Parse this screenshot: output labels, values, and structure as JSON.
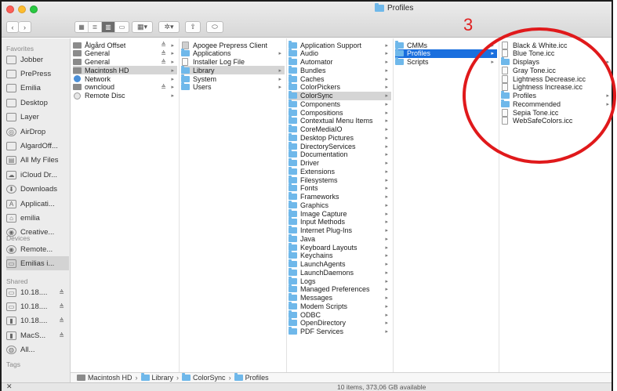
{
  "window": {
    "title": "Profiles"
  },
  "annotation": {
    "number": "3"
  },
  "toolbar": {
    "back": "‹",
    "forward": "›"
  },
  "sidebar": {
    "favorites_heading": "Favorites",
    "favorites": [
      {
        "label": "Jobber",
        "icon": "folder-icon"
      },
      {
        "label": "PrePress",
        "icon": "folder-icon"
      },
      {
        "label": "Emilia",
        "icon": "folder-icon"
      },
      {
        "label": "Desktop",
        "icon": "desktop-icon"
      },
      {
        "label": "Layer",
        "icon": "folder-icon"
      },
      {
        "label": "AirDrop",
        "icon": "airdrop-icon"
      },
      {
        "label": "AlgardOff...",
        "icon": "folder-icon"
      },
      {
        "label": "All My Files",
        "icon": "all-files-icon"
      },
      {
        "label": "iCloud Dr...",
        "icon": "cloud-icon"
      },
      {
        "label": "Downloads",
        "icon": "download-icon"
      },
      {
        "label": "Applicati...",
        "icon": "applications-icon"
      },
      {
        "label": "emilia",
        "icon": "home-icon"
      },
      {
        "label": "Creative...",
        "icon": "creative-cloud-icon"
      }
    ],
    "devices_heading": "Devices",
    "devices": [
      {
        "label": "Remote...",
        "icon": "disc-icon"
      },
      {
        "label": "Emilias i...",
        "icon": "computer-icon",
        "selected": true
      }
    ],
    "shared_heading": "Shared",
    "shared": [
      {
        "label": "10.18....",
        "icon": "display-icon",
        "eject": "≜"
      },
      {
        "label": "10.18....",
        "icon": "display-icon",
        "eject": "≜"
      },
      {
        "label": "10.18....",
        "icon": "server-icon",
        "eject": "≜"
      },
      {
        "label": "MacS...",
        "icon": "server-icon",
        "eject": "≜"
      },
      {
        "label": "All...",
        "icon": "network-icon"
      }
    ],
    "tags_heading": "Tags"
  },
  "columns": {
    "col1": [
      {
        "label": "Ålgård Offset",
        "icon": "drive",
        "eject": "≜",
        "chev": "▸"
      },
      {
        "label": "General",
        "icon": "drive",
        "eject": "≜",
        "chev": "▸"
      },
      {
        "label": "General",
        "icon": "drive",
        "eject": "≜",
        "chev": "▸"
      },
      {
        "label": "Macintosh HD",
        "icon": "drive",
        "chev": "▸",
        "selected": true
      },
      {
        "label": "Network",
        "icon": "net",
        "chev": "▸"
      },
      {
        "label": "owncloud",
        "icon": "drive",
        "eject": "≜",
        "chev": "▸"
      },
      {
        "label": "Remote Disc",
        "icon": "disc",
        "chev": "▸"
      }
    ],
    "col2": [
      {
        "label": "Apogee Prepress Client",
        "icon": "app"
      },
      {
        "label": "Applications",
        "icon": "folder",
        "chev": "▸"
      },
      {
        "label": "Installer Log File",
        "icon": "doc"
      },
      {
        "label": "Library",
        "icon": "folder",
        "chev": "▸",
        "selected": true
      },
      {
        "label": "System",
        "icon": "folder",
        "chev": "▸"
      },
      {
        "label": "Users",
        "icon": "folder",
        "chev": "▸"
      }
    ],
    "col3": [
      {
        "label": "Application Support",
        "icon": "folder",
        "chev": "▸"
      },
      {
        "label": "Audio",
        "icon": "folder",
        "chev": "▸"
      },
      {
        "label": "Automator",
        "icon": "folder",
        "chev": "▸"
      },
      {
        "label": "Bundles",
        "icon": "folder",
        "chev": "▸"
      },
      {
        "label": "Caches",
        "icon": "folder",
        "chev": "▸"
      },
      {
        "label": "ColorPickers",
        "icon": "folder",
        "chev": "▸"
      },
      {
        "label": "ColorSync",
        "icon": "folder",
        "chev": "▸",
        "selected": true
      },
      {
        "label": "Components",
        "icon": "folder",
        "chev": "▸"
      },
      {
        "label": "Compositions",
        "icon": "folder",
        "chev": "▸"
      },
      {
        "label": "Contextual Menu Items",
        "icon": "folder",
        "chev": "▸"
      },
      {
        "label": "CoreMediaIO",
        "icon": "folder",
        "chev": "▸"
      },
      {
        "label": "Desktop Pictures",
        "icon": "folder",
        "chev": "▸"
      },
      {
        "label": "DirectoryServices",
        "icon": "folder",
        "chev": "▸"
      },
      {
        "label": "Documentation",
        "icon": "folder",
        "chev": "▸"
      },
      {
        "label": "Driver",
        "icon": "folder",
        "chev": "▸"
      },
      {
        "label": "Extensions",
        "icon": "folder",
        "chev": "▸"
      },
      {
        "label": "Filesystems",
        "icon": "folder",
        "chev": "▸"
      },
      {
        "label": "Fonts",
        "icon": "folder",
        "chev": "▸"
      },
      {
        "label": "Frameworks",
        "icon": "folder",
        "chev": "▸"
      },
      {
        "label": "Graphics",
        "icon": "folder",
        "chev": "▸"
      },
      {
        "label": "Image Capture",
        "icon": "folder",
        "chev": "▸"
      },
      {
        "label": "Input Methods",
        "icon": "folder",
        "chev": "▸"
      },
      {
        "label": "Internet Plug-Ins",
        "icon": "folder",
        "chev": "▸"
      },
      {
        "label": "Java",
        "icon": "folder",
        "chev": "▸"
      },
      {
        "label": "Keyboard Layouts",
        "icon": "folder",
        "chev": "▸"
      },
      {
        "label": "Keychains",
        "icon": "folder",
        "chev": "▸"
      },
      {
        "label": "LaunchAgents",
        "icon": "folder",
        "chev": "▸"
      },
      {
        "label": "LaunchDaemons",
        "icon": "folder",
        "chev": "▸"
      },
      {
        "label": "Logs",
        "icon": "folder",
        "chev": "▸"
      },
      {
        "label": "Managed Preferences",
        "icon": "folder",
        "chev": "▸"
      },
      {
        "label": "Messages",
        "icon": "folder",
        "chev": "▸"
      },
      {
        "label": "Modem Scripts",
        "icon": "folder",
        "chev": "▸"
      },
      {
        "label": "ODBC",
        "icon": "folder",
        "chev": "▸"
      },
      {
        "label": "OpenDirectory",
        "icon": "folder",
        "chev": "▸"
      },
      {
        "label": "PDF Services",
        "icon": "folder",
        "chev": "▸"
      }
    ],
    "col4": [
      {
        "label": "CMMs",
        "icon": "folder",
        "chev": "▸"
      },
      {
        "label": "Profiles",
        "icon": "folder",
        "chev": "▸",
        "hot": true
      },
      {
        "label": "Scripts",
        "icon": "folder",
        "chev": "▸"
      }
    ],
    "col5": [
      {
        "label": "Black & White.icc",
        "icon": "doc"
      },
      {
        "label": "Blue Tone.icc",
        "icon": "doc"
      },
      {
        "label": "Displays",
        "icon": "folder",
        "chev": "▸"
      },
      {
        "label": "Gray Tone.icc",
        "icon": "doc"
      },
      {
        "label": "Lightness Decrease.icc",
        "icon": "doc"
      },
      {
        "label": "Lightness Increase.icc",
        "icon": "doc"
      },
      {
        "label": "Profiles",
        "icon": "folder",
        "chev": "▸"
      },
      {
        "label": "Recommended",
        "icon": "folder",
        "chev": "▸"
      },
      {
        "label": "Sepia Tone.icc",
        "icon": "doc"
      },
      {
        "label": "WebSafeColors.icc",
        "icon": "doc"
      }
    ]
  },
  "path": [
    {
      "label": "Macintosh HD",
      "icon": "drive"
    },
    {
      "label": "Library",
      "icon": "folder"
    },
    {
      "label": "ColorSync",
      "icon": "folder"
    },
    {
      "label": "Profiles",
      "icon": "folder"
    }
  ],
  "path_separator": "›",
  "status": {
    "text": "10 items, 373,06 GB available",
    "close_glyph": "✕"
  }
}
